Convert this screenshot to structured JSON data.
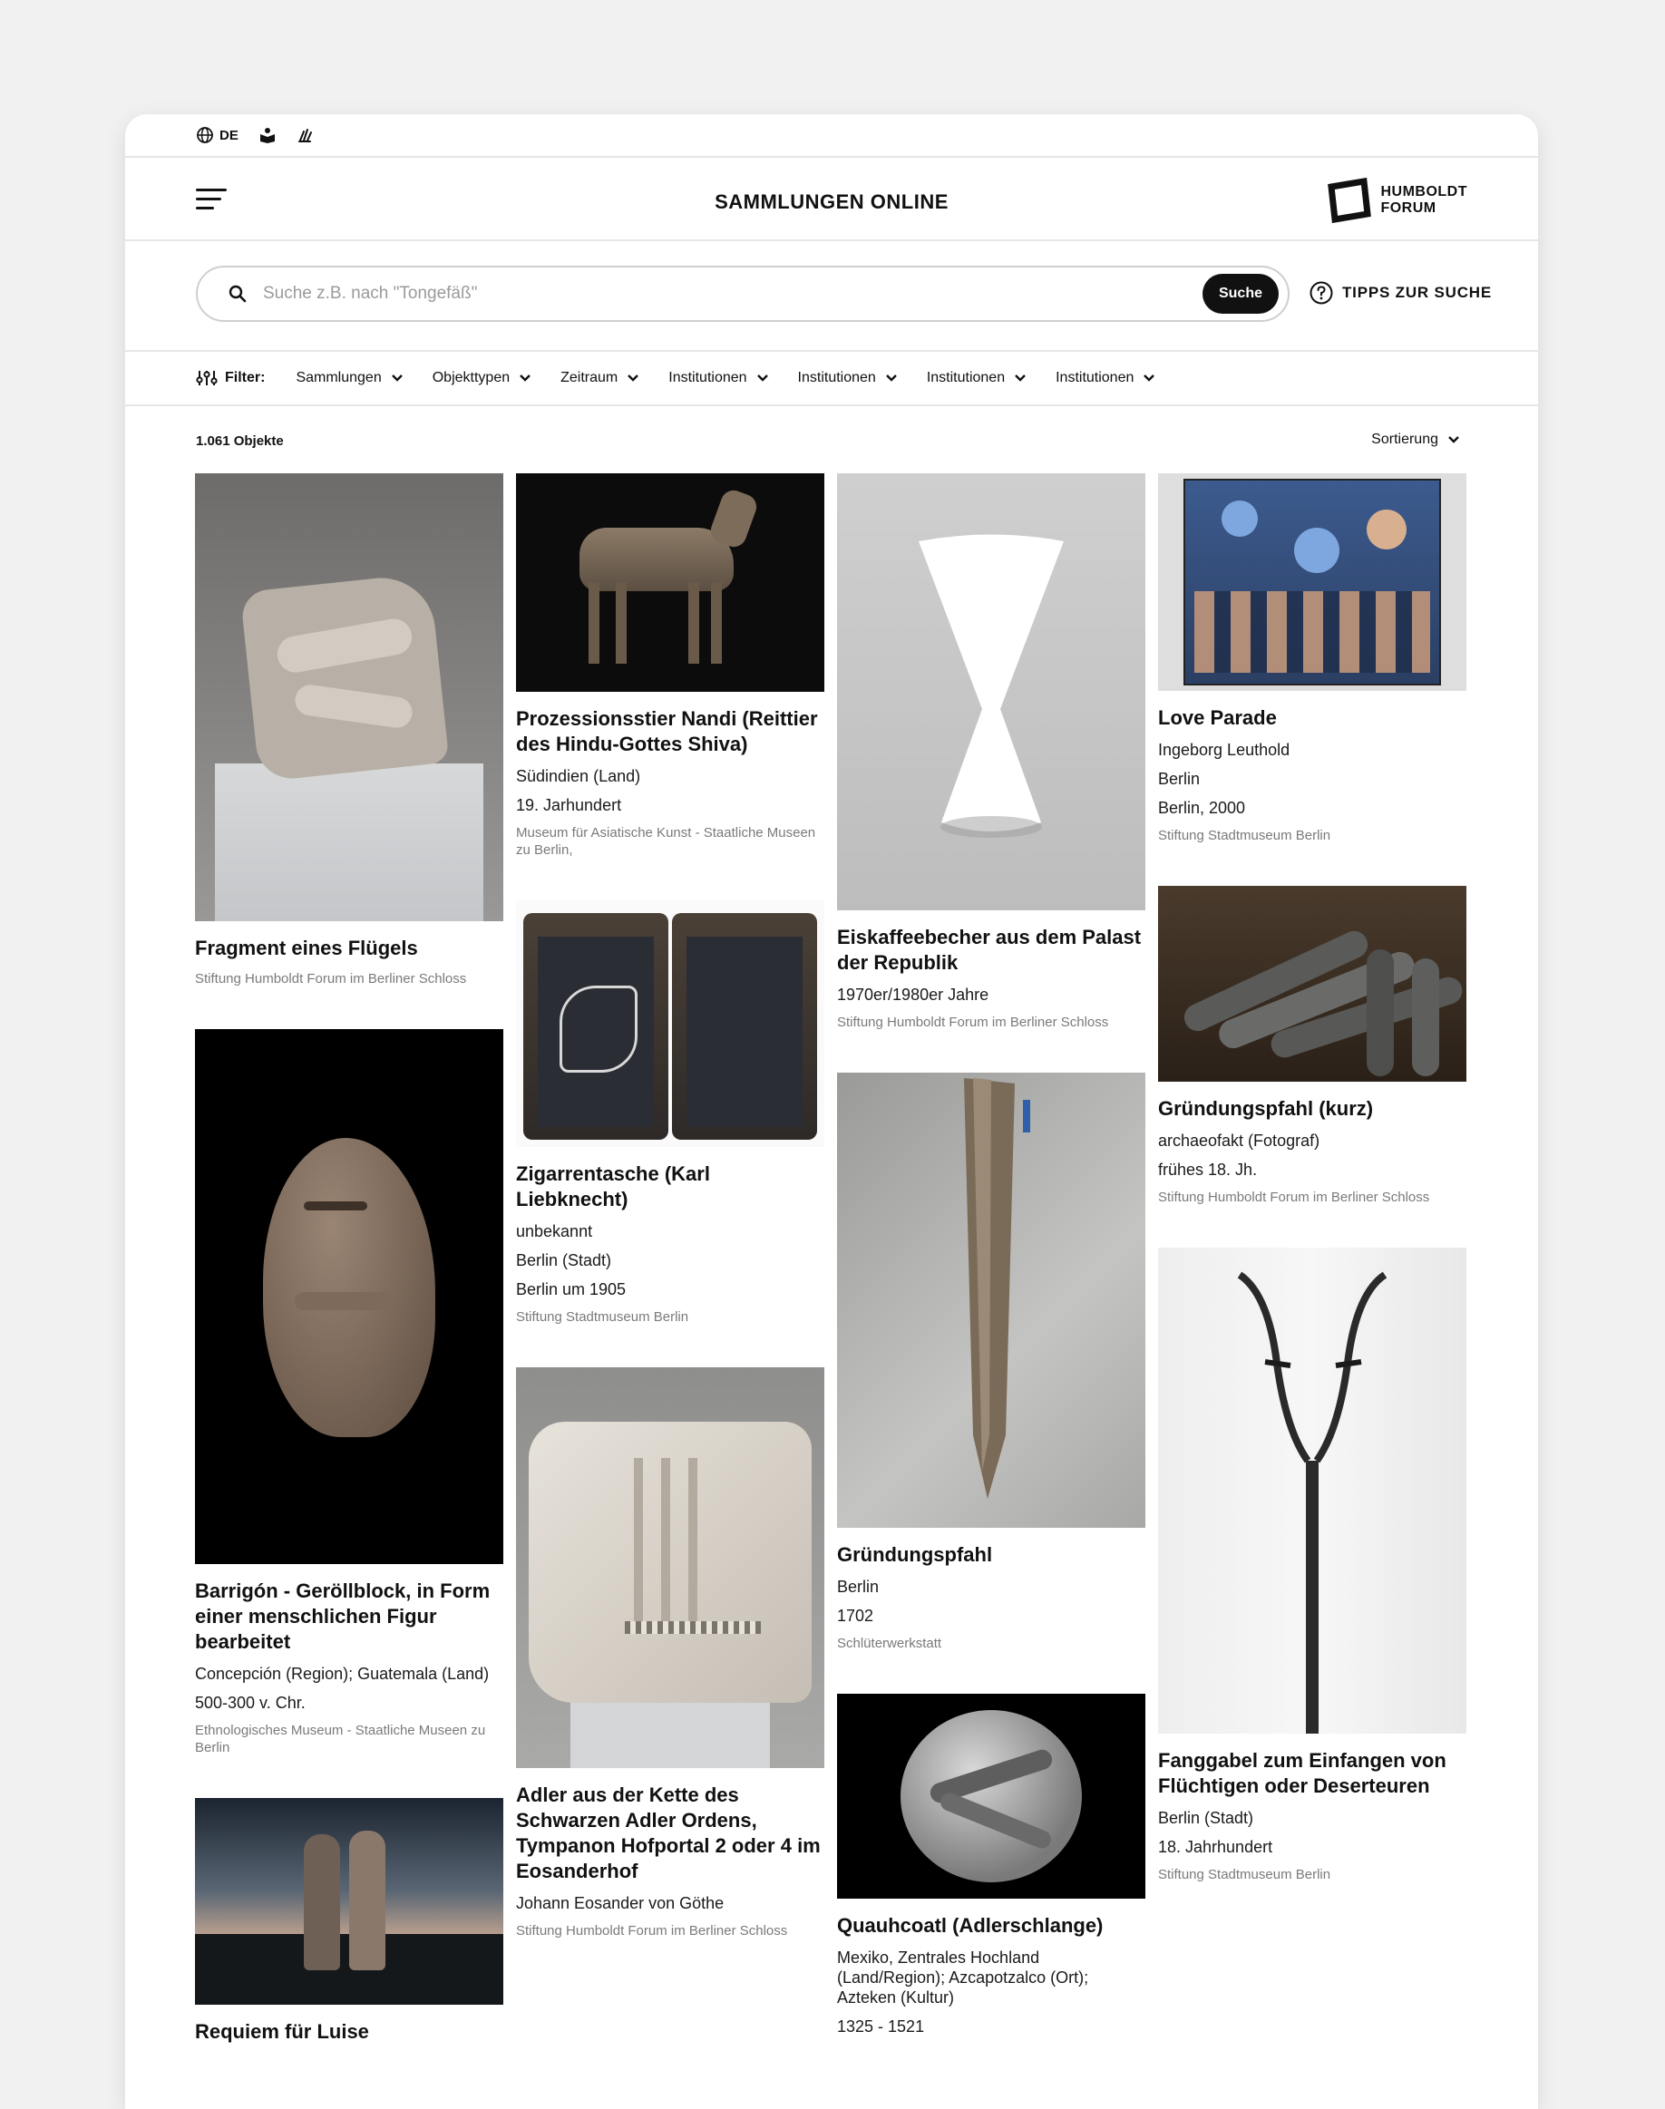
{
  "utility": {
    "language": "DE",
    "icons": [
      "globe-icon",
      "easy-language-icon",
      "sign-language-icon"
    ]
  },
  "header": {
    "title": "SAMMLUNGEN ONLINE",
    "logo_line1": "HUMBOLDT",
    "logo_line2": "FORUM"
  },
  "search": {
    "placeholder": "Suche z.B. nach \"Tongefäß\"",
    "button": "Suche",
    "tips": "TIPPS ZUR SUCHE"
  },
  "filter": {
    "label": "Filter:",
    "items": [
      "Sammlungen",
      "Objekttypen",
      "Zeitraum",
      "Institutionen",
      "Institutionen",
      "Institutionen",
      "Institutionen"
    ]
  },
  "results": {
    "count": "1.061 Objekte",
    "sort_label": "Sortierung"
  },
  "cards": {
    "fragment": {
      "title": "Fragment eines Flügels",
      "inst": "Stiftung Humboldt Forum im Berliner Schloss"
    },
    "barrigon": {
      "title": "Barrigón - Geröllblock, in Form einer menschlichen Figur bearbeitet",
      "line1": "Concepción (Region); Guatemala (Land)",
      "line2": "500-300 v. Chr.",
      "inst": "Ethnologisches Museum - Staatliche Museen zu Berlin"
    },
    "requiem": {
      "title": "Requiem für Luise"
    },
    "nandi": {
      "title": "Prozessionsstier Nandi (Reittier des Hindu-Gottes Shiva)",
      "line1": "Südindien (Land)",
      "line2": "19. Jarhundert",
      "inst": "Museum für Asiatische Kunst - Staatliche Museen zu Berlin,"
    },
    "zigarren": {
      "title": "Zigarrentasche (Karl Liebknecht)",
      "line1": "unbekannt",
      "line2": "Berlin (Stadt)",
      "line3": "Berlin um 1905",
      "inst": "Stiftung Stadtmuseum Berlin"
    },
    "adler": {
      "title": "Adler aus der Kette des Schwarzen Adler Ordens, Tympanon Hofportal 2 oder 4 im Eosanderhof",
      "line1": "Johann Eosander von Göthe",
      "inst": "Stiftung Humboldt Forum im Berliner Schloss"
    },
    "eiskaffee": {
      "title": "Eiskaffeebecher aus dem Palast der Republik",
      "line1": "1970er/1980er Jahre",
      "inst": "Stiftung Humboldt Forum im Berliner Schloss"
    },
    "pfahl": {
      "title": "Gründungspfahl",
      "line1": "Berlin",
      "line2": "1702",
      "inst": "Schlüterwerkstatt"
    },
    "quauh": {
      "title": "Quauhcoatl (Adlerschlange)",
      "line1": "Mexiko, Zentrales Hochland (Land/Region); Azcapotzalco (Ort); Azteken (Kultur)",
      "line2": "1325 - 1521"
    },
    "love": {
      "title": "Love Parade",
      "line1": "Ingeborg Leuthold",
      "line2": "Berlin",
      "line3": "Berlin, 2000",
      "inst": "Stiftung Stadtmuseum Berlin"
    },
    "pfahlkurz": {
      "title": "Gründungspfahl (kurz)",
      "line1": "archaeofakt (Fotograf)",
      "line2": "frühes 18. Jh.",
      "inst": "Stiftung Humboldt Forum im Berliner Schloss"
    },
    "fanggabel": {
      "title": "Fanggabel zum Einfangen von Flüchtigen oder Deserteuren",
      "line1": "Berlin (Stadt)",
      "line2": "18. Jahrhundert",
      "inst": "Stiftung Stadtmuseum Berlin"
    }
  },
  "colors": {
    "text": "#111111",
    "muted": "#7a7a7a",
    "border": "#e6e6e6",
    "button_bg": "#111111",
    "page_bg": "#f1f1f1"
  }
}
